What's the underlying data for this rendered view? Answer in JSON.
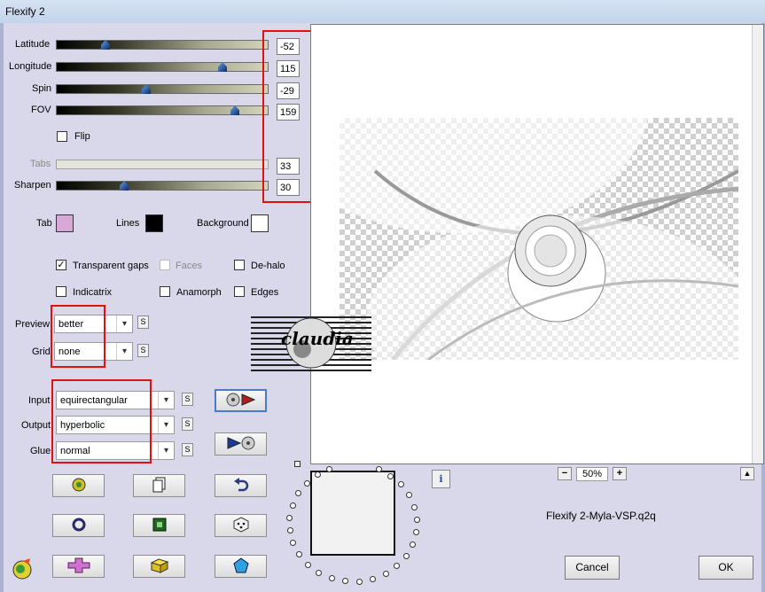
{
  "window": {
    "title": "Flexify 2"
  },
  "sliders": [
    {
      "label": "Latitude",
      "value": "-52",
      "level": 0.22,
      "enabled": true
    },
    {
      "label": "Longitude",
      "value": "115",
      "level": 0.8,
      "enabled": true
    },
    {
      "label": "Spin",
      "value": "-29",
      "level": 0.42,
      "enabled": true
    },
    {
      "label": "FOV",
      "value": "159",
      "level": 0.86,
      "enabled": true
    },
    {
      "label": "Tabs",
      "value": "33",
      "level": 0.0,
      "enabled": false
    },
    {
      "label": "Sharpen",
      "value": "30",
      "level": 0.31,
      "enabled": true
    }
  ],
  "flip": {
    "label": "Flip",
    "checked": false
  },
  "colors": {
    "tab_label": "Tab",
    "tab_color": "#d8a8d8",
    "lines_label": "Lines",
    "lines_color": "#000000",
    "background_label": "Background",
    "background_color": "#ffffff",
    "highlight": "#e01010",
    "accent": "#4a7ad0"
  },
  "options": {
    "transparent_gaps": {
      "label": "Transparent gaps",
      "checked": true
    },
    "faces": {
      "label": "Faces",
      "checked": false
    },
    "de_halo": {
      "label": "De-halo",
      "checked": false
    },
    "indicatrix": {
      "label": "Indicatrix",
      "checked": false
    },
    "anamorph": {
      "label": "Anamorph",
      "checked": false
    },
    "edges": {
      "label": "Edges",
      "checked": false
    }
  },
  "preview": {
    "label": "Preview",
    "value": "better"
  },
  "grid": {
    "label": "Grid",
    "value": "none"
  },
  "input": {
    "label": "Input",
    "value": "equirectangular"
  },
  "output": {
    "label": "Output",
    "value": "hyperbolic"
  },
  "glue": {
    "label": "Glue",
    "value": "normal"
  },
  "s_label": "S",
  "watermark": {
    "text": "claudia"
  },
  "zoom": {
    "minus": "−",
    "value": "50%",
    "plus": "+"
  },
  "info_glyph": "i",
  "preset_name": "Flexify 2-Myla-VSP.q2q",
  "buttons": {
    "cancel": "Cancel",
    "ok": "OK"
  },
  "icons": [
    "render-to-preview-icon",
    "render-from-preview-icon",
    "logo-icon",
    "copy-icon",
    "undo-icon",
    "ring-icon",
    "square-icon",
    "dice-icon",
    "cross-icon",
    "cube-icon",
    "pentagon-icon",
    "info-icon"
  ]
}
